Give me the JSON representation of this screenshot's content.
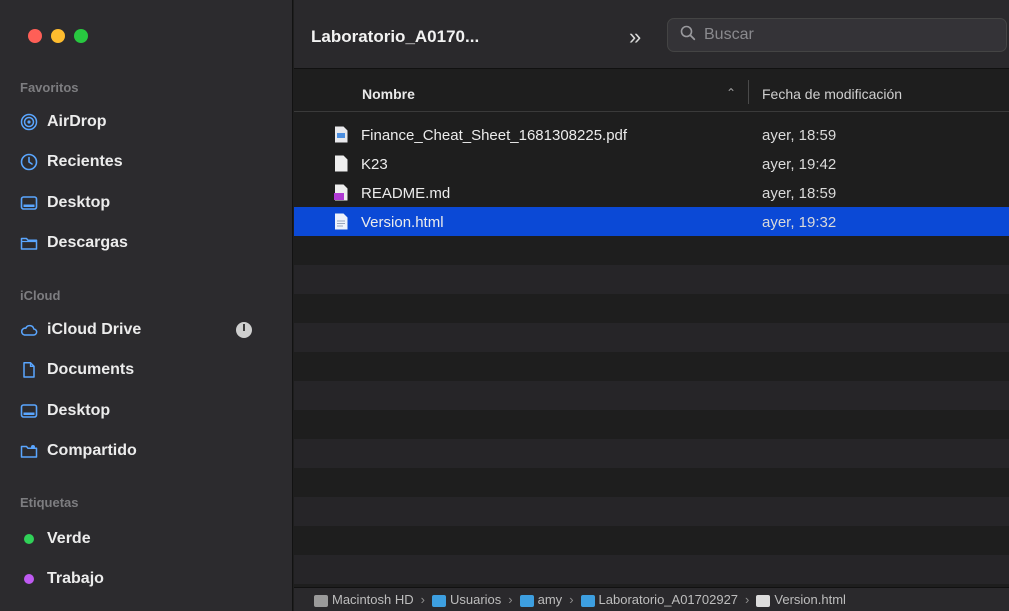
{
  "sidebar": {
    "favorites_label": "Favoritos",
    "favorites": [
      {
        "label": "AirDrop",
        "icon": "airdrop-icon"
      },
      {
        "label": "Recientes",
        "icon": "clock-icon"
      },
      {
        "label": "Desktop",
        "icon": "desktop-icon"
      },
      {
        "label": "Descargas",
        "icon": "folder-icon"
      }
    ],
    "icloud_label": "iCloud",
    "icloud": [
      {
        "label": "iCloud Drive",
        "icon": "cloud-icon"
      },
      {
        "label": "Documents",
        "icon": "document-icon"
      },
      {
        "label": "Desktop",
        "icon": "desktop-icon"
      },
      {
        "label": "Compartido",
        "icon": "shared-folder-icon"
      }
    ],
    "tags_label": "Etiquetas",
    "tags": [
      {
        "label": "Verde",
        "color": "#30d158"
      },
      {
        "label": "Trabajo",
        "color": "#bf5af2"
      }
    ]
  },
  "toolbar": {
    "title": "Laboratorio_A0170...",
    "overflow_glyph": "»",
    "search_placeholder": "Buscar"
  },
  "columns": {
    "name": "Nombre",
    "date": "Fecha de modificación"
  },
  "files": [
    {
      "name": "Finance_Cheat_Sheet_1681308225.pdf",
      "date": "ayer, 18:59",
      "type": "pdf"
    },
    {
      "name": "K23",
      "date": "ayer, 19:42",
      "type": "doc"
    },
    {
      "name": "README.md",
      "date": "ayer, 18:59",
      "type": "md"
    },
    {
      "name": "Version.html",
      "date": "ayer, 19:32",
      "type": "html",
      "selected": true
    }
  ],
  "pathbar": [
    {
      "label": "Macintosh HD",
      "color": "#9a9a9a"
    },
    {
      "label": "Usuarios",
      "color": "#3d9fe0"
    },
    {
      "label": "amy",
      "color": "#3d9fe0"
    },
    {
      "label": "Laboratorio_A01702927",
      "color": "#3d9fe0"
    },
    {
      "label": "Version.html",
      "color": "#dcdcdc"
    }
  ]
}
